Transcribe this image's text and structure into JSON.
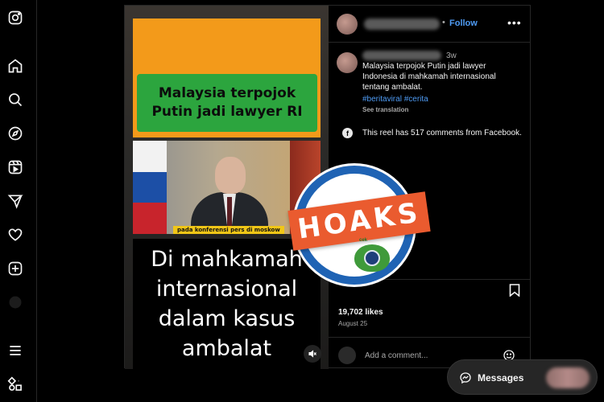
{
  "video": {
    "headline": "Malaysia terpojok\nPutin jadi lawyer RI",
    "photo_caption": "pada konferensi pers di moskow",
    "big_text": "Di mahkamah\ninternasional\ndalam kasus\nambalat"
  },
  "post": {
    "follow_label": "Follow",
    "follow_separator": "•",
    "more_label": "•••",
    "time_ago": "3w",
    "caption": "Malaysia terpojok Putin jadi lawyer\nIndonesia di mahkamah internasional\ntentang ambalat.",
    "hashtags": "#beritaviral #cerita",
    "see_translation": "See translation",
    "facebook_icon_glyph": "f",
    "facebook_note": "This reel has 517 comments from Facebook.",
    "likes": "19,702 likes",
    "date": "August 25",
    "comment_placeholder": "Add a comment..."
  },
  "stamp": {
    "label": "HOAKS",
    "logo_text": "cek"
  },
  "messages": {
    "label": "Messages"
  },
  "colors": {
    "accent_blue": "#4f9cf5",
    "hoaks_orange": "#ea5b2f",
    "ring_blue": "#1f63b4"
  }
}
